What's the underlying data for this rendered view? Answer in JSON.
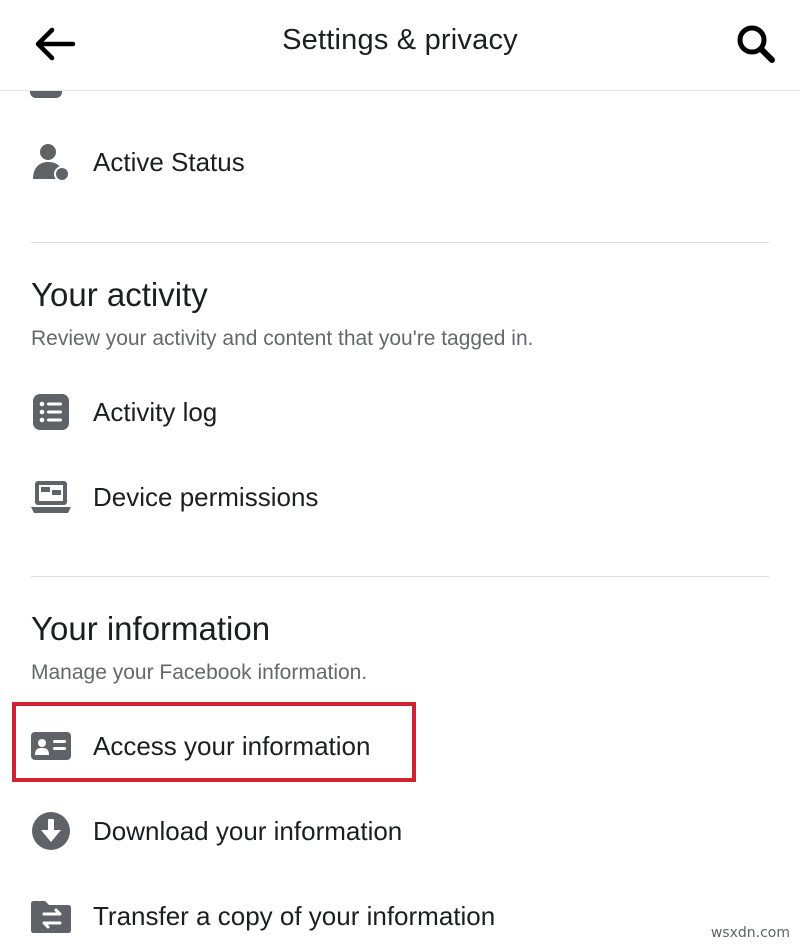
{
  "header": {
    "title": "Settings & privacy",
    "back_icon": "arrow-left-icon",
    "search_icon": "search-icon"
  },
  "peek_item": {
    "label": "Activity log",
    "icon": "storage-icon"
  },
  "top_items": [
    {
      "label": "Active Status",
      "icon": "person-status-icon"
    }
  ],
  "sections": [
    {
      "title": "Your activity",
      "subtitle": "Review your activity and content that you're tagged in.",
      "items": [
        {
          "label": "Activity log",
          "icon": "list-icon"
        },
        {
          "label": "Device permissions",
          "icon": "laptop-icon"
        }
      ]
    },
    {
      "title": "Your information",
      "subtitle": "Manage your Facebook information.",
      "items": [
        {
          "label": "Access your information",
          "icon": "id-card-icon",
          "highlighted": true
        },
        {
          "label": "Download your information",
          "icon": "download-icon"
        },
        {
          "label": "Transfer a copy of your information",
          "icon": "folder-transfer-icon"
        }
      ]
    }
  ],
  "colors": {
    "icon": "#5f6368",
    "text": "#1c1e21",
    "subtext": "#65676b",
    "divider": "#dcdcdc",
    "highlight": "#d0232f"
  },
  "watermark": "wsxdn.com"
}
